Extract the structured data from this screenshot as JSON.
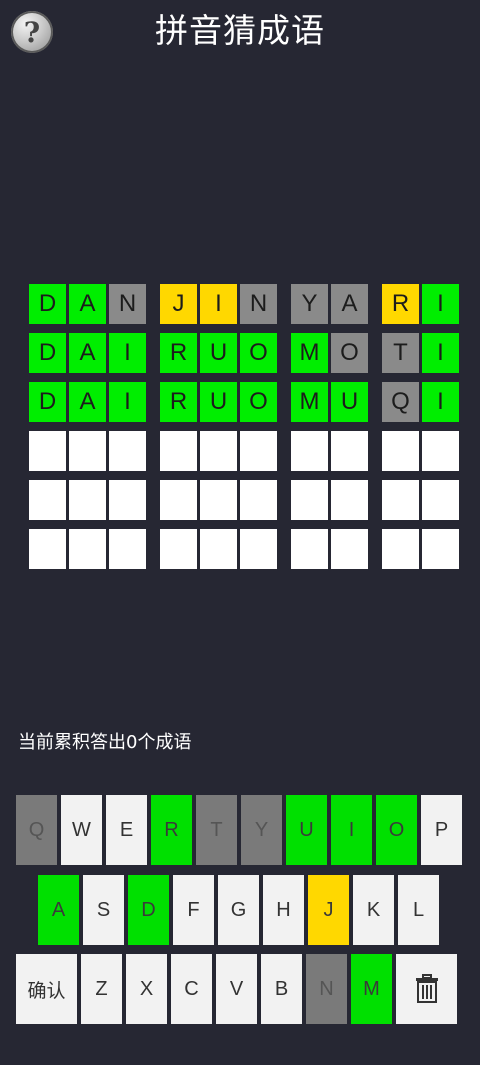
{
  "header": {
    "title": "拼音猜成语",
    "help_icon": "?"
  },
  "colors": {
    "correct": "#00ee00",
    "present": "#ffd800",
    "absent": "#8a8a8a",
    "empty": "#ffffff",
    "background": "#262733"
  },
  "board": {
    "rows": [
      [
        [
          {
            "l": "D",
            "s": "correct"
          },
          {
            "l": "A",
            "s": "correct"
          },
          {
            "l": "N",
            "s": "absent"
          }
        ],
        [
          {
            "l": "J",
            "s": "present"
          },
          {
            "l": "I",
            "s": "present"
          },
          {
            "l": "N",
            "s": "absent"
          }
        ],
        [
          {
            "l": "Y",
            "s": "absent"
          },
          {
            "l": "A",
            "s": "absent"
          }
        ],
        [
          {
            "l": "R",
            "s": "present"
          },
          {
            "l": "I",
            "s": "correct"
          }
        ]
      ],
      [
        [
          {
            "l": "D",
            "s": "correct"
          },
          {
            "l": "A",
            "s": "correct"
          },
          {
            "l": "I",
            "s": "correct"
          }
        ],
        [
          {
            "l": "R",
            "s": "correct"
          },
          {
            "l": "U",
            "s": "correct"
          },
          {
            "l": "O",
            "s": "correct"
          }
        ],
        [
          {
            "l": "M",
            "s": "correct"
          },
          {
            "l": "O",
            "s": "absent"
          }
        ],
        [
          {
            "l": "T",
            "s": "absent"
          },
          {
            "l": "I",
            "s": "correct"
          }
        ]
      ],
      [
        [
          {
            "l": "D",
            "s": "correct"
          },
          {
            "l": "A",
            "s": "correct"
          },
          {
            "l": "I",
            "s": "correct"
          }
        ],
        [
          {
            "l": "R",
            "s": "correct"
          },
          {
            "l": "U",
            "s": "correct"
          },
          {
            "l": "O",
            "s": "correct"
          }
        ],
        [
          {
            "l": "M",
            "s": "correct"
          },
          {
            "l": "U",
            "s": "correct"
          }
        ],
        [
          {
            "l": "Q",
            "s": "absent"
          },
          {
            "l": "I",
            "s": "correct"
          }
        ]
      ],
      [
        [
          {
            "l": "",
            "s": "empty"
          },
          {
            "l": "",
            "s": "empty"
          },
          {
            "l": "",
            "s": "empty"
          }
        ],
        [
          {
            "l": "",
            "s": "empty"
          },
          {
            "l": "",
            "s": "empty"
          },
          {
            "l": "",
            "s": "empty"
          }
        ],
        [
          {
            "l": "",
            "s": "empty"
          },
          {
            "l": "",
            "s": "empty"
          }
        ],
        [
          {
            "l": "",
            "s": "empty"
          },
          {
            "l": "",
            "s": "empty"
          }
        ]
      ],
      [
        [
          {
            "l": "",
            "s": "empty"
          },
          {
            "l": "",
            "s": "empty"
          },
          {
            "l": "",
            "s": "empty"
          }
        ],
        [
          {
            "l": "",
            "s": "empty"
          },
          {
            "l": "",
            "s": "empty"
          },
          {
            "l": "",
            "s": "empty"
          }
        ],
        [
          {
            "l": "",
            "s": "empty"
          },
          {
            "l": "",
            "s": "empty"
          }
        ],
        [
          {
            "l": "",
            "s": "empty"
          },
          {
            "l": "",
            "s": "empty"
          }
        ]
      ],
      [
        [
          {
            "l": "",
            "s": "empty"
          },
          {
            "l": "",
            "s": "empty"
          },
          {
            "l": "",
            "s": "empty"
          }
        ],
        [
          {
            "l": "",
            "s": "empty"
          },
          {
            "l": "",
            "s": "empty"
          },
          {
            "l": "",
            "s": "empty"
          }
        ],
        [
          {
            "l": "",
            "s": "empty"
          },
          {
            "l": "",
            "s": "empty"
          }
        ],
        [
          {
            "l": "",
            "s": "empty"
          },
          {
            "l": "",
            "s": "empty"
          }
        ]
      ]
    ]
  },
  "status_text": "当前累积答出0个成语",
  "keyboard": {
    "row1": [
      {
        "k": "Q",
        "s": "absent"
      },
      {
        "k": "W",
        "s": "normal"
      },
      {
        "k": "E",
        "s": "normal"
      },
      {
        "k": "R",
        "s": "correct"
      },
      {
        "k": "T",
        "s": "absent"
      },
      {
        "k": "Y",
        "s": "absent"
      },
      {
        "k": "U",
        "s": "correct"
      },
      {
        "k": "I",
        "s": "correct"
      },
      {
        "k": "O",
        "s": "correct"
      },
      {
        "k": "P",
        "s": "normal"
      }
    ],
    "row2": [
      {
        "k": "A",
        "s": "correct"
      },
      {
        "k": "S",
        "s": "normal"
      },
      {
        "k": "D",
        "s": "correct"
      },
      {
        "k": "F",
        "s": "normal"
      },
      {
        "k": "G",
        "s": "normal"
      },
      {
        "k": "H",
        "s": "normal"
      },
      {
        "k": "J",
        "s": "present"
      },
      {
        "k": "K",
        "s": "normal"
      },
      {
        "k": "L",
        "s": "normal"
      }
    ],
    "row3": [
      {
        "k": "确认",
        "s": "normal",
        "wide": true
      },
      {
        "k": "Z",
        "s": "normal"
      },
      {
        "k": "X",
        "s": "normal"
      },
      {
        "k": "C",
        "s": "normal"
      },
      {
        "k": "V",
        "s": "normal"
      },
      {
        "k": "B",
        "s": "normal"
      },
      {
        "k": "N",
        "s": "absent"
      },
      {
        "k": "M",
        "s": "correct"
      }
    ],
    "delete_icon": "trash-icon"
  }
}
